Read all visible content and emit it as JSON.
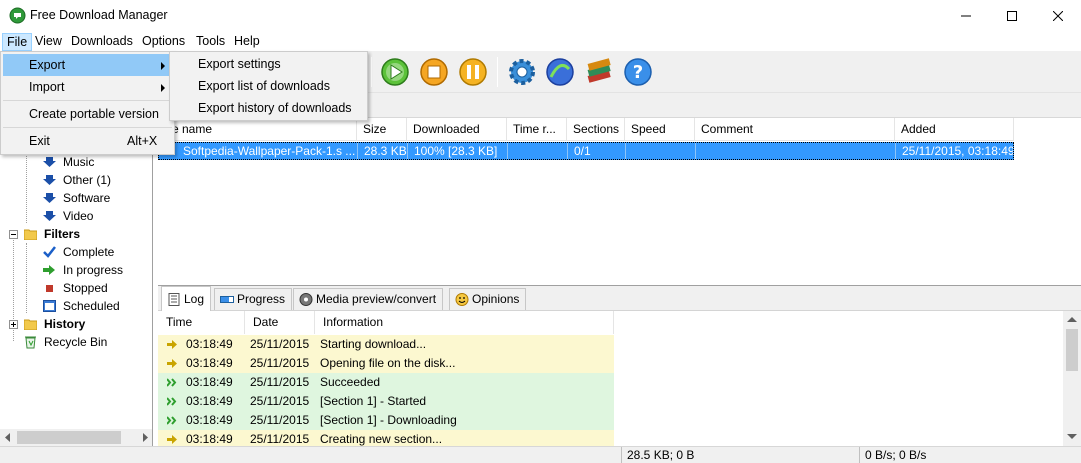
{
  "window": {
    "title": "Free Download Manager"
  },
  "menubar": {
    "items": [
      "File",
      "View",
      "Downloads",
      "Options",
      "Tools",
      "Help"
    ]
  },
  "file_menu": {
    "export": "Export",
    "import": "Import",
    "portable": "Create portable version",
    "exit": "Exit",
    "exit_shortcut": "Alt+X"
  },
  "export_submenu": {
    "items": [
      "Export settings",
      "Export list of downloads",
      "Export history of downloads"
    ]
  },
  "tree": {
    "music": "Music",
    "other": "Other (1)",
    "software": "Software",
    "video": "Video",
    "filters": "Filters",
    "complete": "Complete",
    "in_progress": "In progress",
    "stopped": "Stopped",
    "scheduled": "Scheduled",
    "history": "History",
    "recycle_bin": "Recycle Bin"
  },
  "download_list": {
    "columns": [
      "e name",
      "Size",
      "Downloaded",
      "Time r...",
      "Sections",
      "Speed",
      "Comment",
      "Added"
    ],
    "rows": [
      {
        "name": "Softpedia-Wallpaper-Pack-1.s ...",
        "size": "28.3 KB",
        "downloaded": "100% [28.3 KB]",
        "time_remaining": "",
        "sections": "0/1",
        "speed": "",
        "comment": "",
        "added": "25/11/2015, 03:18:49"
      }
    ]
  },
  "bottom_tabs": [
    "Log",
    "Progress",
    "Media preview/convert",
    "Opinions"
  ],
  "log": {
    "columns": [
      "Time",
      "Date",
      "Information"
    ],
    "rows": [
      {
        "time": "03:18:49",
        "date": "25/11/2015",
        "info": "Starting download...",
        "kind": "yellow"
      },
      {
        "time": "03:18:49",
        "date": "25/11/2015",
        "info": "Opening file on the disk...",
        "kind": "yellow"
      },
      {
        "time": "03:18:49",
        "date": "25/11/2015",
        "info": "Succeeded",
        "kind": "green"
      },
      {
        "time": "03:18:49",
        "date": "25/11/2015",
        "info": "[Section 1] - Started",
        "kind": "green"
      },
      {
        "time": "03:18:49",
        "date": "25/11/2015",
        "info": "[Section 1] - Downloading",
        "kind": "green"
      },
      {
        "time": "03:18:49",
        "date": "25/11/2015",
        "info": "Creating new section...",
        "kind": "yellow"
      }
    ]
  },
  "statusbar": {
    "traffic": "28.5 KB; 0 B",
    "speed": "0 B/s; 0 B/s"
  },
  "colors": {
    "selection": "#3399ff",
    "menu_highlight": "#91c9f7",
    "log_info": "#fcf8d0",
    "log_success": "#dff6df"
  }
}
